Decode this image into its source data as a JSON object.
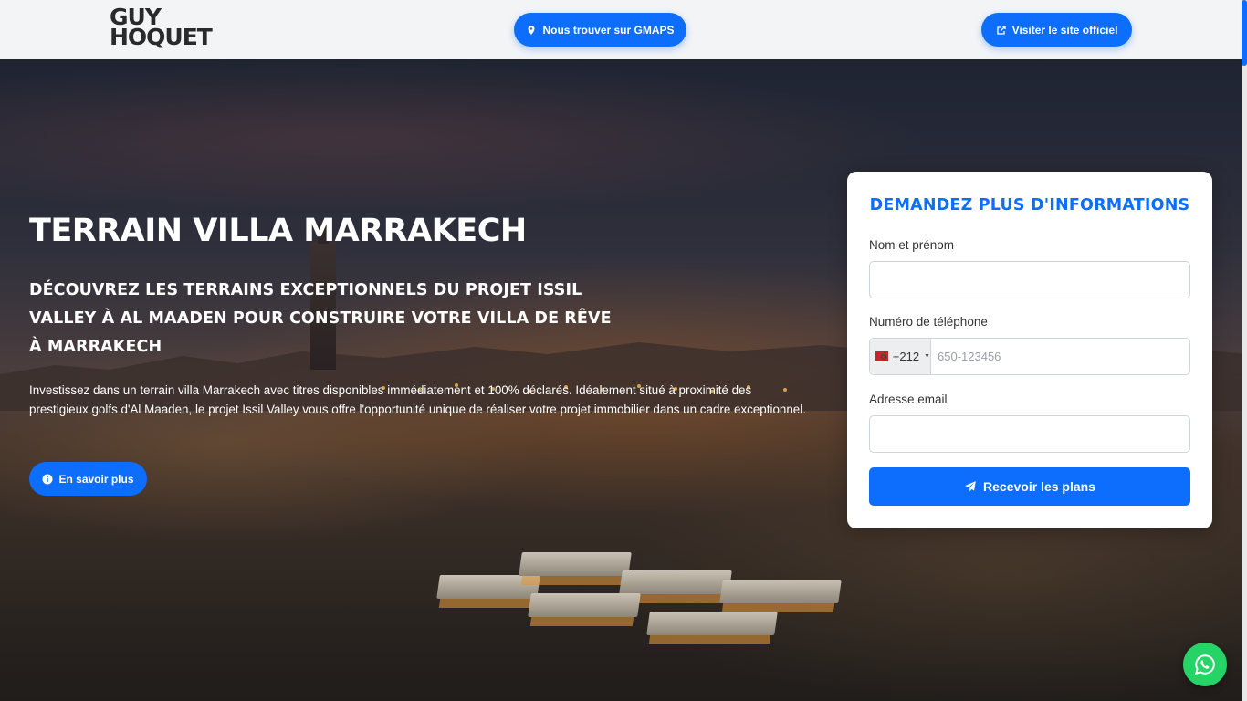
{
  "header": {
    "logo_line1": "GUY",
    "logo_line2": "HOQUET",
    "gmaps_button": "Nous trouver sur GMAPS",
    "site_button": "Visiter le site officiel"
  },
  "hero": {
    "title": "TERRAIN VILLA MARRAKECH",
    "subtitle": "DÉCOUVREZ LES TERRAINS EXCEPTIONNELS DU PROJET ISSIL VALLEY À AL MAADEN POUR CONSTRUIRE VOTRE VILLA DE RÊVE À MARRAKECH",
    "description": "Investissez dans un terrain villa Marrakech avec titres disponibles immédiatement et 100% déclarés. Idéalement situé à proximité des prestigieux golfs d'Al Maaden, le projet Issil Valley vous offre l'opportunité unique de réaliser votre projet immobilier dans un cadre exceptionnel.",
    "more_button": "En savoir plus"
  },
  "form": {
    "title": "DEMANDEZ PLUS D'INFORMATIONS",
    "name_label": "Nom et prénom",
    "name_value": "",
    "phone_label": "Numéro de téléphone",
    "phone_country_code": "+212",
    "phone_placeholder": "650-123456",
    "email_label": "Adresse email",
    "email_value": "",
    "submit_label": "Recevoir les plans"
  },
  "icons": {
    "gmaps": "map-marker-icon",
    "site": "external-link-icon",
    "more": "info-circle-icon",
    "submit": "paper-plane-icon",
    "chat": "whatsapp-icon"
  },
  "colors": {
    "accent": "#0d6efd",
    "whatsapp": "#25d366",
    "header_bg": "#f3f4f6"
  }
}
